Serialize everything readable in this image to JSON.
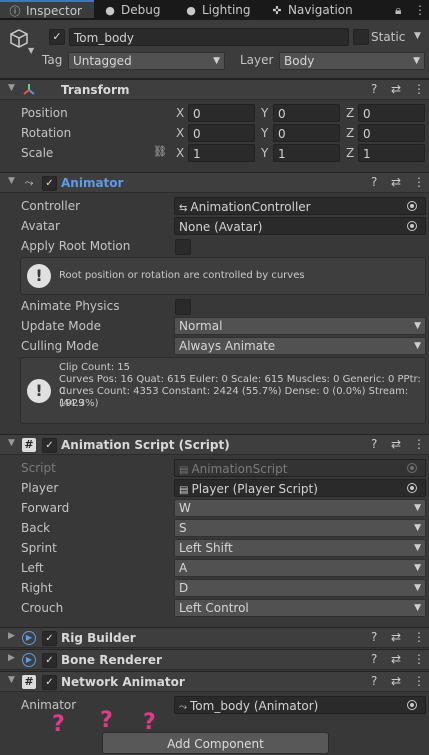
{
  "tabs": [
    {
      "icon": "ⓘ",
      "label": "Inspector"
    },
    {
      "icon": "●",
      "label": "Debug"
    },
    {
      "icon": "●",
      "label": "Lighting"
    },
    {
      "icon": "✜",
      "label": "Navigation"
    }
  ],
  "object": {
    "name": "Tom_body",
    "static_label": "Static",
    "tag_label": "Tag",
    "tag_value": "Untagged",
    "layer_label": "Layer",
    "layer_value": "Body"
  },
  "transform": {
    "title": "Transform",
    "rows": [
      {
        "label": "Position",
        "x": "0",
        "y": "0",
        "z": "0"
      },
      {
        "label": "Rotation",
        "x": "0",
        "y": "0",
        "z": "0"
      },
      {
        "label": "Scale",
        "x": "1",
        "y": "1",
        "z": "1"
      }
    ],
    "axes": {
      "x": "X",
      "y": "Y",
      "z": "Z"
    }
  },
  "animator": {
    "title": "Animator",
    "controller_label": "Controller",
    "controller_value": "AnimationController",
    "avatar_label": "Avatar",
    "avatar_value": "None (Avatar)",
    "root_motion_label": "Apply Root Motion",
    "info1": "Root position or rotation are controlled by curves",
    "animate_physics_label": "Animate Physics",
    "update_mode_label": "Update Mode",
    "update_mode_value": "Normal",
    "culling_mode_label": "Culling Mode",
    "culling_mode_value": "Always Animate",
    "stats": [
      "Clip Count: 15",
      "Curves Pos: 16 Quat: 615 Euler: 0 Scale: 615 Muscles: 0 Generic: 0 PPtr: 0",
      "Curves Count: 4353 Constant: 2424 (55.7%) Dense: 0 (0.0%) Stream: 1929",
      "(44.3%)"
    ]
  },
  "script": {
    "title": "Animation Script (Script)",
    "script_label": "Script",
    "script_value": "AnimationScript",
    "player_label": "Player",
    "player_value": "Player (Player Script)",
    "rows": [
      {
        "label": "Forward",
        "value": "W"
      },
      {
        "label": "Back",
        "value": "S"
      },
      {
        "label": "Sprint",
        "value": "Left Shift"
      },
      {
        "label": "Left",
        "value": "A"
      },
      {
        "label": "Right",
        "value": "D"
      },
      {
        "label": "Crouch",
        "value": "Left Control"
      }
    ]
  },
  "rig_builder": {
    "title": "Rig Builder"
  },
  "bone_renderer": {
    "title": "Bone Renderer"
  },
  "network_animator": {
    "title": "Network Animator",
    "animator_label": "Animator",
    "animator_value": "Tom_body (Animator)"
  },
  "add_component": "Add Component",
  "annotations": [
    "?",
    "?",
    "?"
  ]
}
